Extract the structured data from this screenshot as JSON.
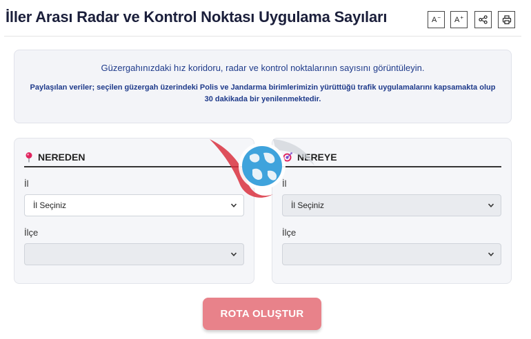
{
  "header": {
    "title": "İller Arası Radar ve Kontrol Noktası Uygulama Sayıları",
    "font_decrease_label": "A",
    "font_decrease_sup": "−",
    "font_increase_label": "A",
    "font_increase_sup": "+"
  },
  "info": {
    "main": "Güzergahınızdaki hız koridoru, radar ve kontrol noktalarının sayısını görüntüleyin.",
    "sub": "Paylaşılan veriler; seçilen güzergah üzerindeki Polis ve Jandarma birimlerimizin yürüttüğü trafik uygulamalarını kapsamakta olup 30 dakikada bir yenilenmektedir."
  },
  "from": {
    "title": "NEREDEN",
    "il_label": "İl",
    "il_value": "İl Seçiniz",
    "ilce_label": "İlçe",
    "ilce_value": ""
  },
  "to": {
    "title": "NEREYE",
    "il_label": "İl",
    "il_value": "İl Seçiniz",
    "ilce_label": "İlçe",
    "ilce_value": ""
  },
  "route_button": "ROTA OLUŞTUR",
  "colors": {
    "title": "#1b1f3b",
    "info_text": "#1e3a8a",
    "button": "#e8828a",
    "pin": "#e0245e"
  },
  "icons": {
    "share": "share-icon",
    "print": "printer-icon",
    "from": "map-pin-icon",
    "to": "target-icon"
  }
}
